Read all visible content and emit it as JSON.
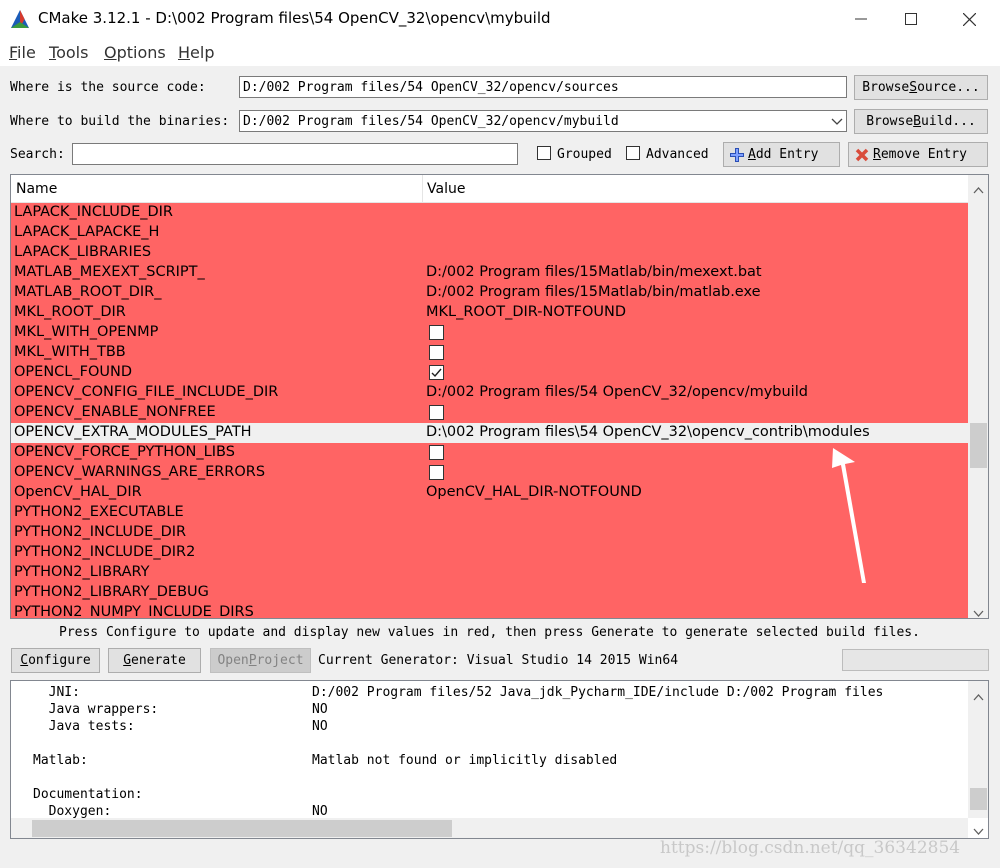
{
  "window": {
    "title": "CMake 3.12.1 - D:\\002 Program files\\54 OpenCV_32\\opencv\\mybuild",
    "minimize": "—",
    "maximize": "☐",
    "close": "✕"
  },
  "menu": [
    {
      "label": "File",
      "ul": "F",
      "rest": "ile"
    },
    {
      "label": "Tools",
      "ul": "T",
      "rest": "ools"
    },
    {
      "label": "Options",
      "ul": "O",
      "rest": "ptions"
    },
    {
      "label": "Help",
      "ul": "H",
      "rest": "elp"
    }
  ],
  "source": {
    "label": "Where is the source code:",
    "value": "D:/002 Program files/54 OpenCV_32/opencv/sources",
    "browse_ul": "B",
    "browse_pre": "Browse ",
    "browse_key": "S",
    "browse_post": "ource..."
  },
  "build": {
    "label": "Where to build the binaries:",
    "value": "D:/002 Program files/54 OpenCV_32/opencv/mybuild",
    "browse_pre": "Browse ",
    "browse_key": "B",
    "browse_post": "uild..."
  },
  "search": {
    "label": "Search:",
    "value": "",
    "grouped": "Grouped",
    "advanced": "Advanced",
    "add_entry": "Add Entry",
    "add_key": "A",
    "add_rest": "dd Entry",
    "remove_entry": "Remove Entry",
    "remove_key": "R",
    "remove_rest": "emove Entry"
  },
  "table": {
    "col_name": "Name",
    "col_value": "Value",
    "rows": [
      {
        "name": "LAPACK_INCLUDE_DIR",
        "value": "",
        "type": "text",
        "highlight": true
      },
      {
        "name": "LAPACK_LAPACKE_H",
        "value": "",
        "type": "text",
        "highlight": true
      },
      {
        "name": "LAPACK_LIBRARIES",
        "value": "",
        "type": "text",
        "highlight": true
      },
      {
        "name": "MATLAB_MEXEXT_SCRIPT_",
        "value": "D:/002 Program files/15Matlab/bin/mexext.bat",
        "type": "text",
        "highlight": true
      },
      {
        "name": "MATLAB_ROOT_DIR_",
        "value": "D:/002 Program files/15Matlab/bin/matlab.exe",
        "type": "text",
        "highlight": true
      },
      {
        "name": "MKL_ROOT_DIR",
        "value": "MKL_ROOT_DIR-NOTFOUND",
        "type": "text",
        "highlight": true
      },
      {
        "name": "MKL_WITH_OPENMP",
        "value": "",
        "type": "bool",
        "checked": false,
        "highlight": true
      },
      {
        "name": "MKL_WITH_TBB",
        "value": "",
        "type": "bool",
        "checked": false,
        "highlight": true
      },
      {
        "name": "OPENCL_FOUND",
        "value": "",
        "type": "bool",
        "checked": true,
        "highlight": true
      },
      {
        "name": "OPENCV_CONFIG_FILE_INCLUDE_DIR",
        "value": "D:/002 Program files/54 OpenCV_32/opencv/mybuild",
        "type": "text",
        "highlight": true
      },
      {
        "name": "OPENCV_ENABLE_NONFREE",
        "value": "",
        "type": "bool",
        "checked": false,
        "highlight": true
      },
      {
        "name": "OPENCV_EXTRA_MODULES_PATH",
        "value": "D:\\002 Program files\\54 OpenCV_32\\opencv_contrib\\modules",
        "type": "text",
        "highlight": false
      },
      {
        "name": "OPENCV_FORCE_PYTHON_LIBS",
        "value": "",
        "type": "bool",
        "checked": false,
        "highlight": true
      },
      {
        "name": "OPENCV_WARNINGS_ARE_ERRORS",
        "value": "",
        "type": "bool",
        "checked": false,
        "highlight": true
      },
      {
        "name": "OpenCV_HAL_DIR",
        "value": "OpenCV_HAL_DIR-NOTFOUND",
        "type": "text",
        "highlight": true
      },
      {
        "name": "PYTHON2_EXECUTABLE",
        "value": "",
        "type": "text",
        "highlight": true
      },
      {
        "name": "PYTHON2_INCLUDE_DIR",
        "value": "",
        "type": "text",
        "highlight": true
      },
      {
        "name": "PYTHON2_INCLUDE_DIR2",
        "value": "",
        "type": "text",
        "highlight": true
      },
      {
        "name": "PYTHON2_LIBRARY",
        "value": "",
        "type": "text",
        "highlight": true
      },
      {
        "name": "PYTHON2_LIBRARY_DEBUG",
        "value": "",
        "type": "text",
        "highlight": true
      },
      {
        "name": "PYTHON2_NUMPY_INCLUDE_DIRS",
        "value": "",
        "type": "text",
        "highlight": true
      }
    ]
  },
  "status_text": "Press Configure to update and display new values in red, then press Generate to generate selected build files.",
  "actions": {
    "configure": "Configure",
    "configure_key": "C",
    "configure_rest": "onfigure",
    "generate": "Generate",
    "generate_key": "G",
    "generate_rest": "enerate",
    "open_project": "Open Project",
    "open_pre": "Open ",
    "open_key": "P",
    "open_post": "roject",
    "generator": "Current Generator: Visual Studio 14 2015 Win64"
  },
  "output": {
    "lines": [
      {
        "label": "  JNI:",
        "value": "D:/002 Program files/52 Java_jdk_Pycharm_IDE/include D:/002 Program files"
      },
      {
        "label": "  Java wrappers:",
        "value": "NO"
      },
      {
        "label": "  Java tests:",
        "value": "NO"
      },
      {
        "label": "",
        "value": ""
      },
      {
        "label": "Matlab:",
        "value": "Matlab not found or implicitly disabled"
      },
      {
        "label": "",
        "value": ""
      },
      {
        "label": "Documentation:",
        "value": ""
      },
      {
        "label": "  Doxygen:",
        "value": "NO"
      }
    ]
  },
  "watermark": "https://blog.csdn.net/qq_36342854",
  "colors": {
    "highlight_row": "#ff6464",
    "selected_row": "#f0f0f0",
    "arrow": "#ffffff"
  }
}
